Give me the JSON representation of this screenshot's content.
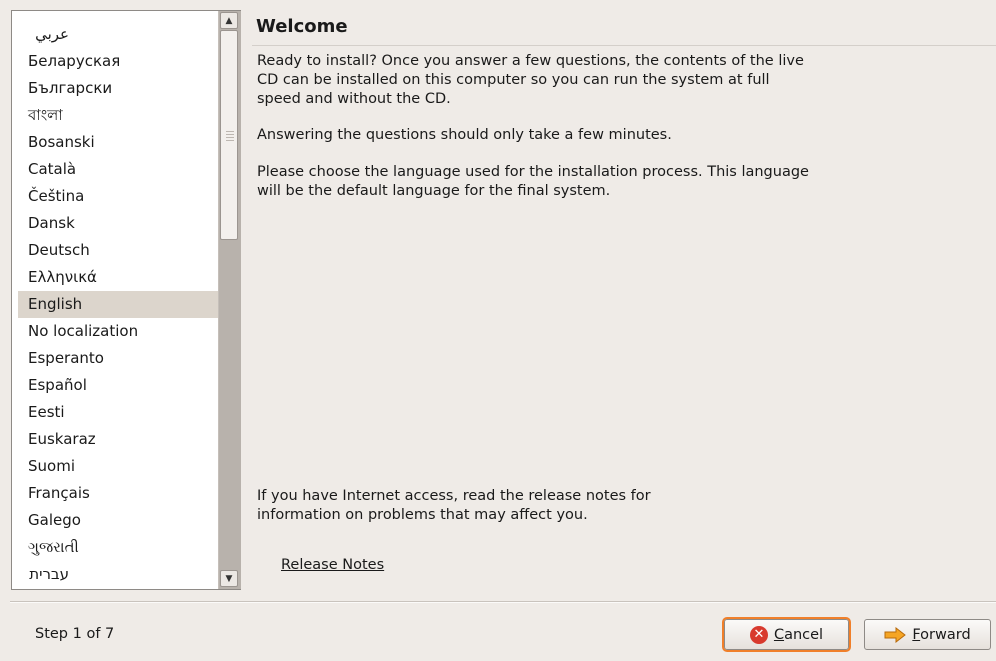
{
  "languages": [
    {
      "label": "عربي",
      "rtl": true
    },
    {
      "label": "Беларуская"
    },
    {
      "label": "Български"
    },
    {
      "label": "বাংলা"
    },
    {
      "label": "Bosanski"
    },
    {
      "label": "Català"
    },
    {
      "label": "Čeština"
    },
    {
      "label": "Dansk"
    },
    {
      "label": "Deutsch"
    },
    {
      "label": "Ελληνικά"
    },
    {
      "label": "English",
      "selected": true
    },
    {
      "label": "No localization"
    },
    {
      "label": "Esperanto"
    },
    {
      "label": "Español"
    },
    {
      "label": "Eesti"
    },
    {
      "label": "Euskaraz"
    },
    {
      "label": "Suomi"
    },
    {
      "label": "Français"
    },
    {
      "label": "Galego"
    },
    {
      "label": "ગુજરાતી"
    },
    {
      "label": "עברית",
      "rtl": true
    }
  ],
  "welcome": {
    "title": "Welcome",
    "para1": "Ready to install? Once you answer a few questions, the contents of the live CD can be installed on this computer so you can run the system at full speed and without the CD.",
    "para2": "Answering the questions should only take a few minutes.",
    "para3": "Please choose the language used for the installation process. This language will be the default language for the final system.",
    "para4": "If you have Internet access, read the release notes for information on problems that may affect you.",
    "release_notes_link": "Release Notes"
  },
  "footer": {
    "step_text": "Step 1 of 7",
    "cancel_mnemonic": "C",
    "cancel_rest": "ancel",
    "forward_mnemonic": "F",
    "forward_rest": "orward"
  },
  "colors": {
    "background": "#efebe7",
    "selection": "#dcd5cc",
    "focus_outline": "#f07f2a",
    "cancel_icon": "#d83a2e",
    "forward_icon": "#f5a524"
  },
  "icons": {
    "cancel": "cancel-icon",
    "forward": "forward-arrow-icon",
    "scroll_up": "scroll-up-arrow-icon",
    "scroll_down": "scroll-down-arrow-icon"
  }
}
